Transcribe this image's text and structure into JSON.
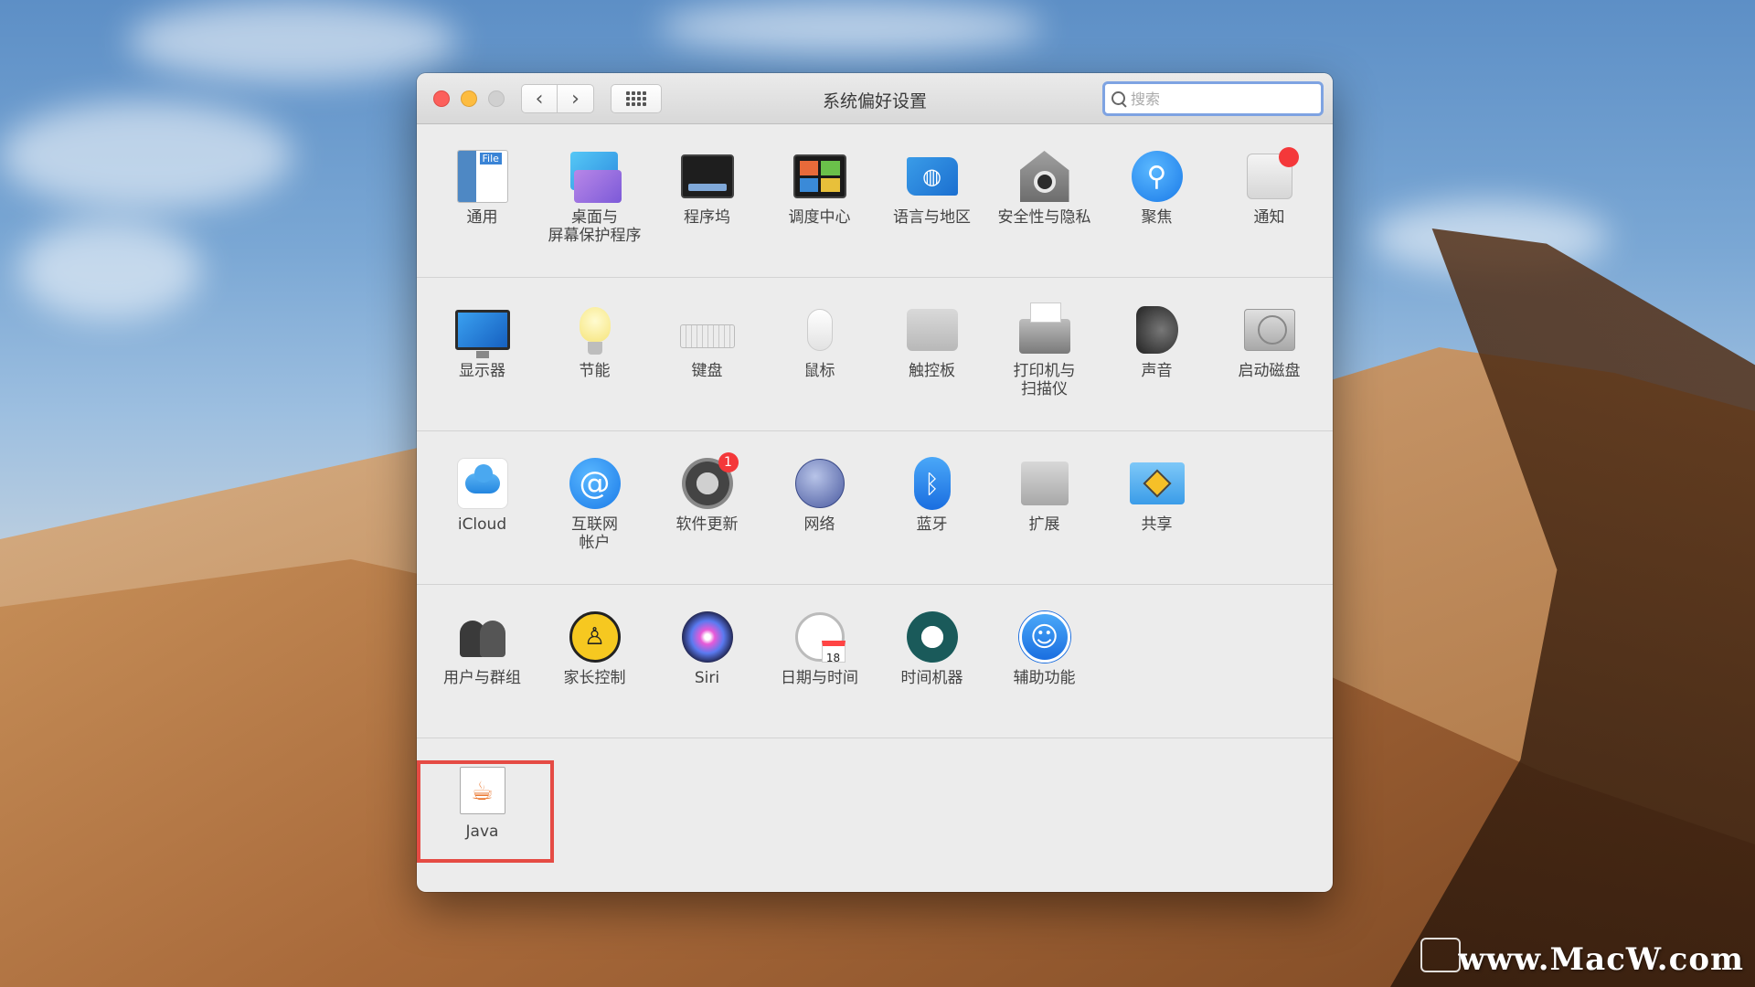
{
  "window": {
    "title": "系统偏好设置",
    "search_placeholder": "搜索"
  },
  "sections": [
    [
      {
        "name": "general",
        "label": "通用",
        "icon": "general-icon"
      },
      {
        "name": "desktop",
        "label": "桌面与\n屏幕保护程序",
        "icon": "desktop-screensaver-icon"
      },
      {
        "name": "dock",
        "label": "程序坞",
        "icon": "dock-icon"
      },
      {
        "name": "mission-control",
        "label": "调度中心",
        "icon": "mission-control-icon"
      },
      {
        "name": "language",
        "label": "语言与地区",
        "icon": "language-region-icon"
      },
      {
        "name": "security",
        "label": "安全性与隐私",
        "icon": "security-privacy-icon"
      },
      {
        "name": "spotlight",
        "label": "聚焦",
        "icon": "spotlight-icon"
      },
      {
        "name": "notifications",
        "label": "通知",
        "icon": "notifications-icon"
      }
    ],
    [
      {
        "name": "displays",
        "label": "显示器",
        "icon": "display-icon"
      },
      {
        "name": "energy",
        "label": "节能",
        "icon": "energy-saver-icon"
      },
      {
        "name": "keyboard",
        "label": "键盘",
        "icon": "keyboard-icon"
      },
      {
        "name": "mouse",
        "label": "鼠标",
        "icon": "mouse-icon"
      },
      {
        "name": "trackpad",
        "label": "触控板",
        "icon": "trackpad-icon"
      },
      {
        "name": "printers",
        "label": "打印机与\n扫描仪",
        "icon": "printer-icon"
      },
      {
        "name": "sound",
        "label": "声音",
        "icon": "sound-icon"
      },
      {
        "name": "startup-disk",
        "label": "启动磁盘",
        "icon": "startup-disk-icon"
      }
    ],
    [
      {
        "name": "icloud",
        "label": "iCloud",
        "icon": "icloud-icon"
      },
      {
        "name": "internet-accounts",
        "label": "互联网\n帐户",
        "icon": "internet-accounts-icon"
      },
      {
        "name": "software-update",
        "label": "软件更新",
        "icon": "software-update-icon",
        "badge": "1"
      },
      {
        "name": "network",
        "label": "网络",
        "icon": "network-icon"
      },
      {
        "name": "bluetooth",
        "label": "蓝牙",
        "icon": "bluetooth-icon"
      },
      {
        "name": "extensions",
        "label": "扩展",
        "icon": "extensions-icon"
      },
      {
        "name": "sharing",
        "label": "共享",
        "icon": "sharing-icon"
      }
    ],
    [
      {
        "name": "users-groups",
        "label": "用户与群组",
        "icon": "users-groups-icon"
      },
      {
        "name": "parental-controls",
        "label": "家长控制",
        "icon": "parental-controls-icon"
      },
      {
        "name": "siri",
        "label": "Siri",
        "icon": "siri-icon"
      },
      {
        "name": "date-time",
        "label": "日期与时间",
        "icon": "date-time-icon",
        "cal_day": "18"
      },
      {
        "name": "time-machine",
        "label": "时间机器",
        "icon": "time-machine-icon"
      },
      {
        "name": "accessibility",
        "label": "辅助功能",
        "icon": "accessibility-icon"
      }
    ],
    [
      {
        "name": "java",
        "label": "Java",
        "icon": "java-icon"
      }
    ]
  ],
  "watermark": "www.MacW.com",
  "colors": {
    "highlight": "#e54b44",
    "search_focus": "#7ea3e2",
    "badge": "#f4383a"
  }
}
